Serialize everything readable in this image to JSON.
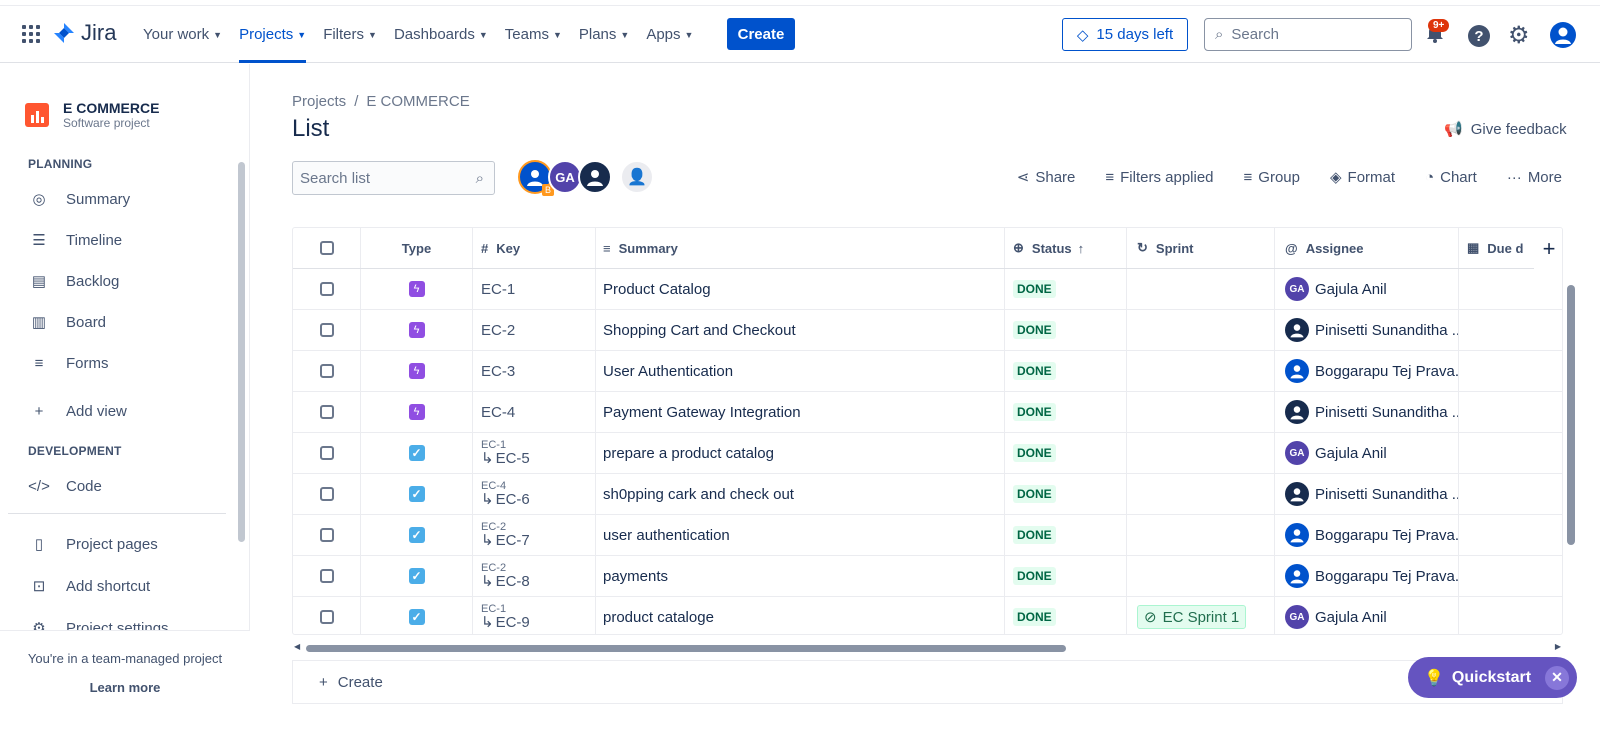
{
  "topnav": {
    "logo": "Jira",
    "items": [
      {
        "label": "Your work",
        "active": false
      },
      {
        "label": "Projects",
        "active": true
      },
      {
        "label": "Filters",
        "active": false
      },
      {
        "label": "Dashboards",
        "active": false
      },
      {
        "label": "Teams",
        "active": false
      },
      {
        "label": "Plans",
        "active": false
      },
      {
        "label": "Apps",
        "active": false
      }
    ],
    "create": "Create",
    "trial": "15 days left",
    "search_placeholder": "Search",
    "notif_count": "9+"
  },
  "sidebar": {
    "project_name": "E COMMERCE",
    "project_type": "Software project",
    "planning_label": "PLANNING",
    "planning": [
      {
        "label": "Summary",
        "icon": "globe-icon"
      },
      {
        "label": "Timeline",
        "icon": "timeline-icon"
      },
      {
        "label": "Backlog",
        "icon": "backlog-icon"
      },
      {
        "label": "Board",
        "icon": "board-icon"
      },
      {
        "label": "Forms",
        "icon": "forms-icon"
      }
    ],
    "add_view": "Add view",
    "development_label": "DEVELOPMENT",
    "code": "Code",
    "project_pages": "Project pages",
    "add_shortcut": "Add shortcut",
    "project_settings": "Project settings",
    "footer_text": "You're in a team-managed project",
    "learn_more": "Learn more"
  },
  "main": {
    "breadcrumb_root": "Projects",
    "breadcrumb_project": "E COMMERCE",
    "title": "List",
    "give_feedback": "Give feedback",
    "search_placeholder": "Search list",
    "toolbar": {
      "share": "Share",
      "filters": "Filters applied",
      "group": "Group",
      "format": "Format",
      "chart": "Chart",
      "more": "More"
    },
    "columns": {
      "type": "Type",
      "key": "Key",
      "summary": "Summary",
      "status": "Status",
      "sprint": "Sprint",
      "assignee": "Assignee",
      "due": "Due d"
    },
    "rows": [
      {
        "type": "epic",
        "parent": "",
        "key": "EC-1",
        "summary": "Product Catalog",
        "status": "DONE",
        "sprint": "",
        "assignee": "Gajula Anil",
        "av": "GA"
      },
      {
        "type": "epic",
        "parent": "",
        "key": "EC-2",
        "summary": "Shopping Cart and Checkout",
        "status": "DONE",
        "sprint": "",
        "assignee": "Pinisetti Sunanditha ...",
        "av": "dark"
      },
      {
        "type": "epic",
        "parent": "",
        "key": "EC-3",
        "summary": "User Authentication",
        "status": "DONE",
        "sprint": "",
        "assignee": "Boggarapu Tej Prava...",
        "av": "blue"
      },
      {
        "type": "epic",
        "parent": "",
        "key": "EC-4",
        "summary": "Payment Gateway Integration",
        "status": "DONE",
        "sprint": "",
        "assignee": "Pinisetti Sunanditha ...",
        "av": "dark"
      },
      {
        "type": "task",
        "parent": "EC-1",
        "key": "EC-5",
        "summary": "prepare a product catalog",
        "status": "DONE",
        "sprint": "",
        "assignee": "Gajula Anil",
        "av": "GA"
      },
      {
        "type": "task",
        "parent": "EC-4",
        "key": "EC-6",
        "summary": "sh0pping cark and check out",
        "status": "DONE",
        "sprint": "",
        "assignee": "Pinisetti Sunanditha ...",
        "av": "dark"
      },
      {
        "type": "task",
        "parent": "EC-2",
        "key": "EC-7",
        "summary": "user authentication",
        "status": "DONE",
        "sprint": "",
        "assignee": "Boggarapu Tej Prava...",
        "av": "blue"
      },
      {
        "type": "task",
        "parent": "EC-2",
        "key": "EC-8",
        "summary": "payments",
        "status": "DONE",
        "sprint": "",
        "assignee": "Boggarapu Tej Prava...",
        "av": "blue"
      },
      {
        "type": "task",
        "parent": "EC-1",
        "key": "EC-9",
        "summary": "product cataloge",
        "status": "DONE",
        "sprint": "EC Sprint 1",
        "assignee": "Gajula Anil",
        "av": "GA"
      }
    ],
    "create_row": "Create",
    "quickstart": "Quickstart",
    "colors": {
      "accent": "#0052cc",
      "done_bg": "#e3fcef",
      "epic": "#904ee2",
      "task": "#4bade8",
      "quickstart": "#6554c0"
    }
  }
}
